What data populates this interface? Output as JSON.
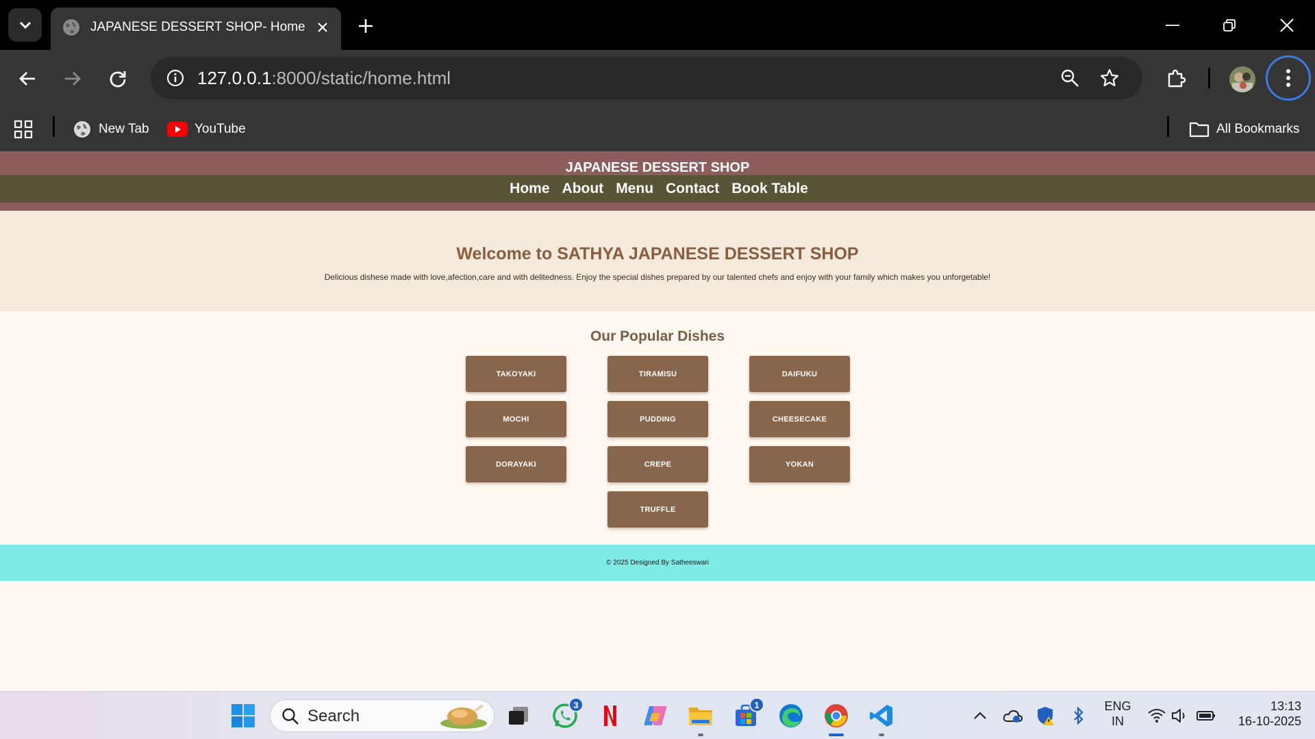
{
  "browser": {
    "tab_title": "JAPANESE DESSERT SHOP- Home",
    "url_host": "127.0.0.1",
    "url_rest": ":8000/static/home.html",
    "bookmarks": [
      {
        "label": "New Tab",
        "icon": "globe-icon"
      },
      {
        "label": "YouTube",
        "icon": "youtube-icon"
      }
    ],
    "all_bookmarks_label": "All Bookmarks"
  },
  "site": {
    "title": "JAPANESE DESSERT SHOP",
    "nav": [
      "Home",
      "About",
      "Menu",
      "Contact",
      "Book Table"
    ],
    "hero_heading": "Welcome to SATHYA JAPANESE DESSERT SHOP",
    "hero_text": "Delicious dishese made with love,afection,care and with delitedness. Enjoy the special dishes prepared by our talented chefs and enjoy with your family which makes you unforgetable!",
    "popular_heading": "Our Popular Dishes",
    "dishes": [
      "TAKOYAKI",
      "TIRAMISU",
      "DAIFUKU",
      "MOCHI",
      "PUDDING",
      "CHEESECAKE",
      "DORAYAKI",
      "CREPE",
      "YOKAN",
      "TRUFFLE"
    ],
    "footer": "© 2025 Designed By Satheeswari"
  },
  "taskbar": {
    "search_placeholder": "Search",
    "whatsapp_badge": "3",
    "store_badge": "1",
    "lang_primary": "ENG",
    "lang_secondary": "IN",
    "time": "13:13",
    "date": "16-10-2025"
  },
  "colors": {
    "header_bg": "#8d5d5d",
    "nav_bg": "#585436",
    "hero_bg": "#f6eadc",
    "dish_button": "#87664b",
    "footer_bg": "#7eebe6"
  }
}
